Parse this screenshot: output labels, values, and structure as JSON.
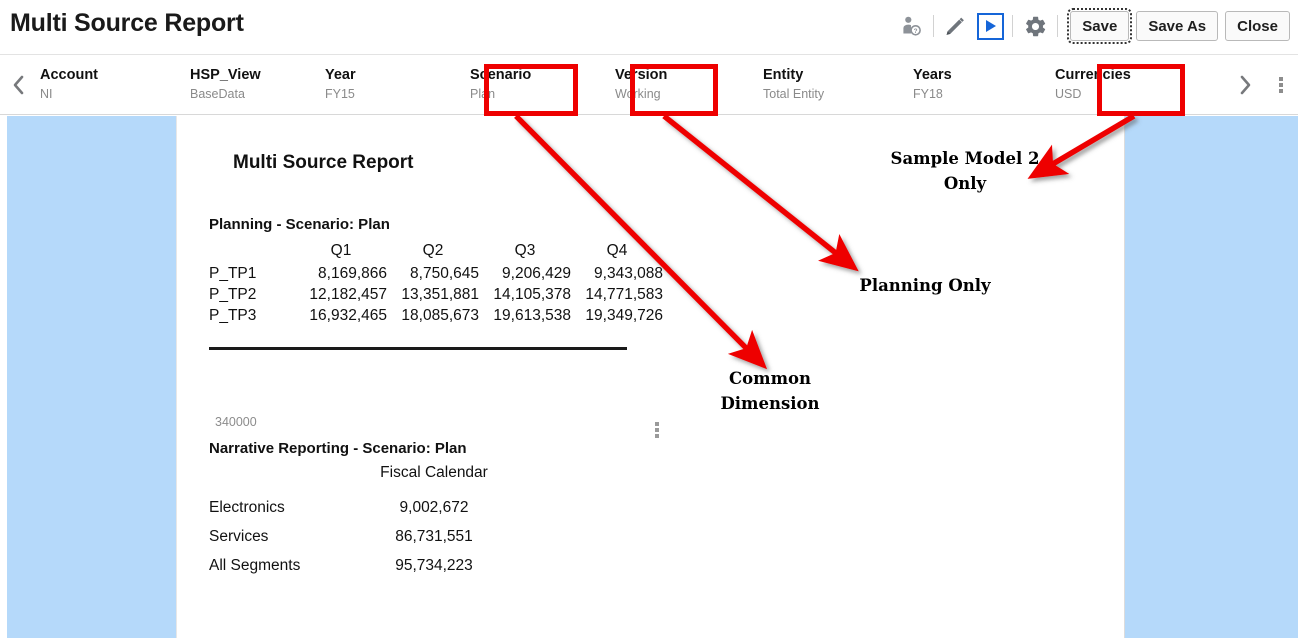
{
  "window": {
    "title": "Multi Source Report"
  },
  "toolbar": {
    "icons": [
      {
        "name": "user-approval-icon",
        "glyph": "user-badge"
      },
      {
        "name": "edit-pencil-icon",
        "glyph": "pencil"
      },
      {
        "name": "run-play-icon",
        "glyph": "play"
      },
      {
        "name": "settings-gear-icon",
        "glyph": "gear"
      }
    ],
    "save_label": "Save",
    "save_as_label": "Save As",
    "close_label": "Close"
  },
  "pov": {
    "prev_label": "‹",
    "next_label": "›",
    "items": [
      {
        "name": "Account",
        "value": "NI",
        "highlighted": false
      },
      {
        "name": "HSP_View",
        "value": "BaseData",
        "highlighted": false
      },
      {
        "name": "Year",
        "value": "FY15",
        "highlighted": false
      },
      {
        "name": "Scenario",
        "value": "Plan",
        "highlighted": true
      },
      {
        "name": "Version",
        "value": "Working",
        "highlighted": true
      },
      {
        "name": "Entity",
        "value": "Total Entity",
        "highlighted": false
      },
      {
        "name": "Years",
        "value": "FY18",
        "highlighted": false
      },
      {
        "name": "Currencies",
        "value": "USD",
        "highlighted": true
      }
    ]
  },
  "report": {
    "title": "Multi Source Report",
    "planning": {
      "heading": "Planning - Scenario: Plan",
      "columns": [
        "Q1",
        "Q2",
        "Q3",
        "Q4"
      ],
      "rows": [
        {
          "label": "P_TP1",
          "values": [
            "8,169,866",
            "8,750,645",
            "9,206,429",
            "9,343,088"
          ]
        },
        {
          "label": "P_TP2",
          "values": [
            "12,182,457",
            "13,351,881",
            "14,105,378",
            "14,771,583"
          ]
        },
        {
          "label": "P_TP3",
          "values": [
            "16,932,465",
            "18,085,673",
            "19,613,538",
            "19,349,726"
          ]
        }
      ]
    },
    "account_code": "340000",
    "narrative": {
      "heading": "Narrative Reporting - Scenario: Plan",
      "column_header": "Fiscal\nCalendar",
      "rows": [
        {
          "label": "Electronics",
          "value": "9,002,672"
        },
        {
          "label": "Services",
          "value": "86,731,551"
        },
        {
          "label": "All Segments",
          "value": "95,734,223"
        }
      ]
    }
  },
  "annotations": {
    "accent_color": "#ee0000",
    "callouts": [
      {
        "id": "sample-model-2-only",
        "text": "Sample Model 2\nOnly"
      },
      {
        "id": "planning-only",
        "text": "Planning Only"
      },
      {
        "id": "common-dimension",
        "text": "Common\nDimension"
      }
    ]
  },
  "colors": {
    "side_panel": "#b5d9fa",
    "play_accent": "#1565d8",
    "annotation_red": "#ee0000"
  }
}
